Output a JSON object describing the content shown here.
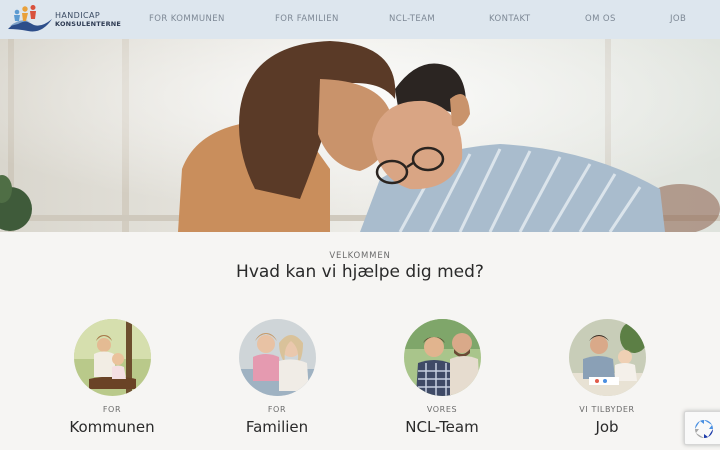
{
  "brand": {
    "line1": "HANDICAP",
    "line2": "KONSULENTERNE"
  },
  "nav": [
    {
      "label": "FOR KOMMUNEN"
    },
    {
      "label": "FOR FAMILIEN"
    },
    {
      "label": "NCL-TEAM"
    },
    {
      "label": "KONTAKT"
    },
    {
      "label": "OM OS"
    },
    {
      "label": "JOB"
    }
  ],
  "welcome": {
    "eyebrow": "VELKOMMEN",
    "headline": "Hvad kan vi hjælpe dig med?"
  },
  "cards": [
    {
      "small": "FOR",
      "big": "Kommunen"
    },
    {
      "small": "FOR",
      "big": "Familien"
    },
    {
      "small": "VORES",
      "big": "NCL-Team"
    },
    {
      "small": "VI TILBYDER",
      "big": "Job"
    }
  ],
  "colors": {
    "header_bg": "#dde6ee",
    "page_bg": "#f6f5f3",
    "nav_text": "#7d8895",
    "logo_navy": "#2d3a52"
  },
  "icons": {
    "recaptcha": "recaptcha-icon",
    "logo": "logo-icon"
  }
}
